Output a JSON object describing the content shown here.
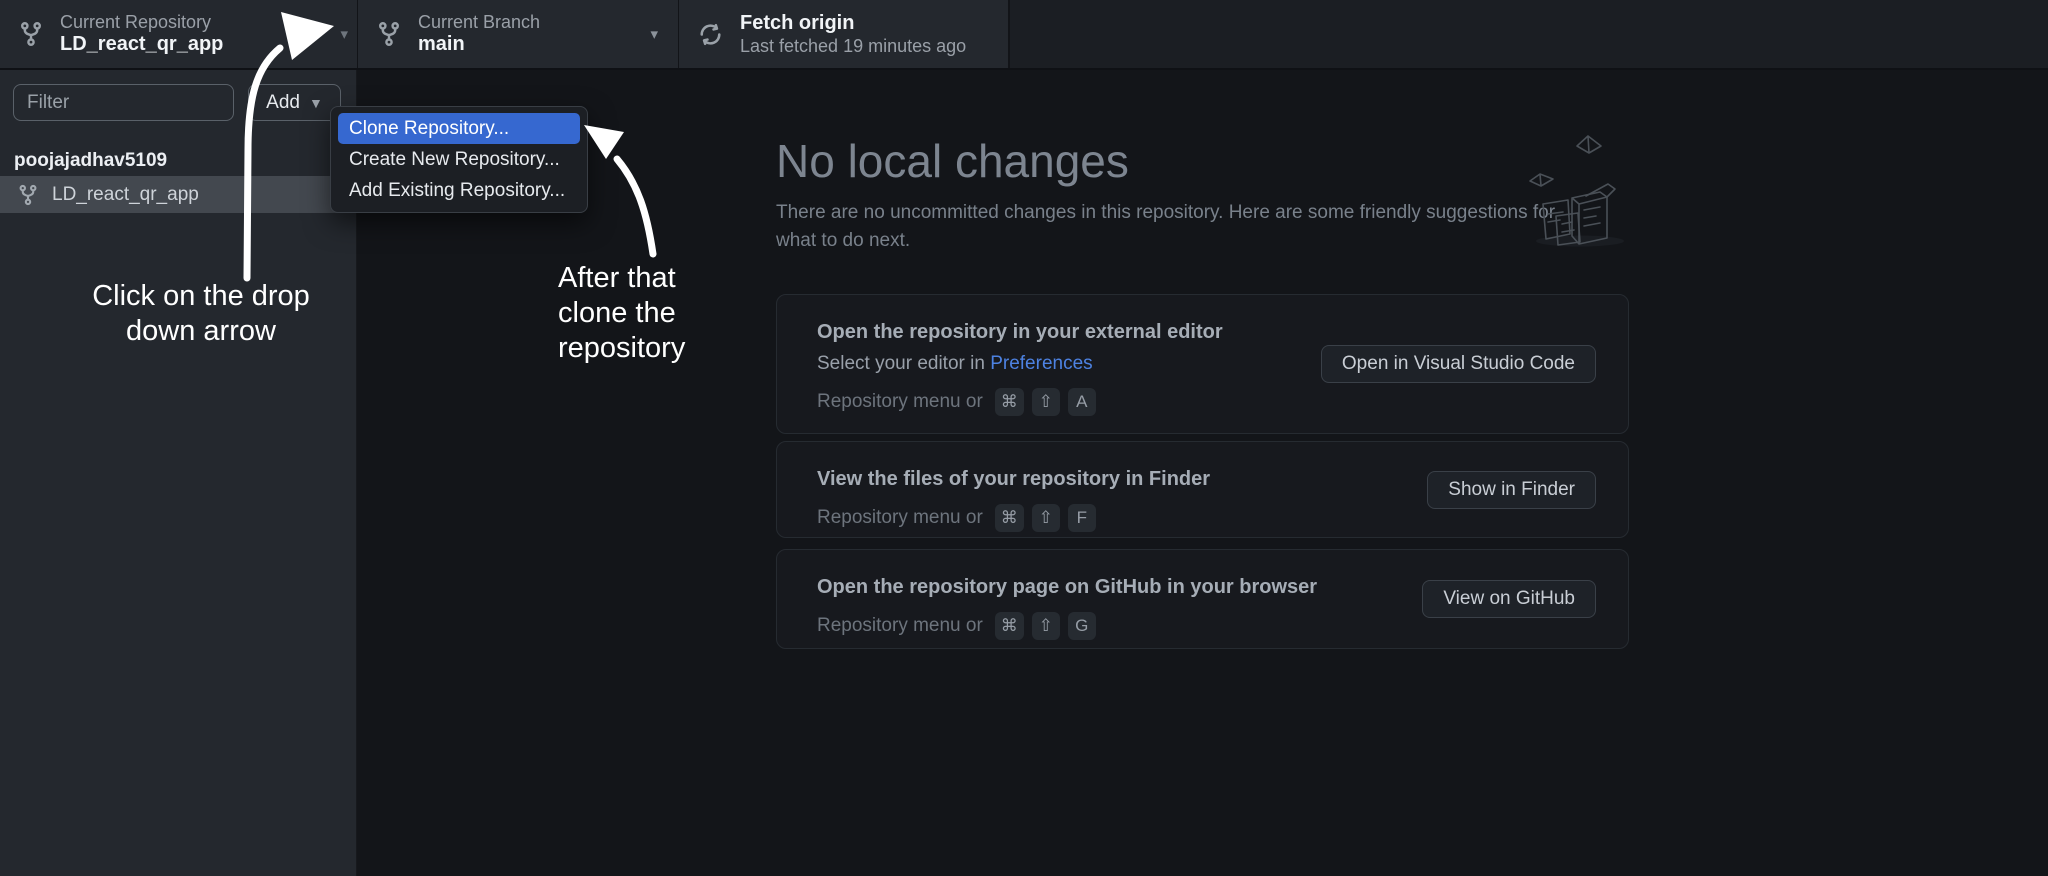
{
  "toolbar": {
    "repo_label": "Current Repository",
    "repo_value": "LD_react_qr_app",
    "branch_label": "Current Branch",
    "branch_value": "main",
    "fetch_label": "Fetch origin",
    "fetch_sublabel": "Last fetched 19 minutes ago"
  },
  "sidebar": {
    "filter_placeholder": "Filter",
    "add_button_label": "Add",
    "group_header": "poojajadhav5109",
    "repo_item": "LD_react_qr_app"
  },
  "add_menu": {
    "items": [
      {
        "label": "Clone Repository...",
        "highlighted": true
      },
      {
        "label": "Create New Repository...",
        "highlighted": false
      },
      {
        "label": "Add Existing Repository...",
        "highlighted": false
      }
    ]
  },
  "main": {
    "title": "No local changes",
    "subtitle": "There are no uncommitted changes in this repository. Here are some friendly suggestions for what to do next.",
    "cards": [
      {
        "title": "Open the repository in your external editor",
        "line2_prefix": "Select your editor in",
        "line2_link": "Preferences",
        "shortcut_prefix": "Repository menu or",
        "keys": [
          "⌘",
          "⇧",
          "A"
        ],
        "button_label": "Open in Visual Studio Code"
      },
      {
        "title": "View the files of your repository in Finder",
        "shortcut_prefix": "Repository menu or",
        "keys": [
          "⌘",
          "⇧",
          "F"
        ],
        "button_label": "Show in Finder"
      },
      {
        "title": "Open the repository page on GitHub in your browser",
        "shortcut_prefix": "Repository menu or",
        "keys": [
          "⌘",
          "⇧",
          "G"
        ],
        "button_label": "View on GitHub"
      }
    ]
  },
  "annotations": {
    "note1_line1": "Click on the drop",
    "note1_line2": "down arrow",
    "note2_line1": "After that",
    "note2_line2": "clone the",
    "note2_line3": "repository"
  },
  "colors": {
    "menu_highlight": "#3668d0",
    "link_blue": "#4d82e2",
    "annotation_white": "#ffffff"
  }
}
